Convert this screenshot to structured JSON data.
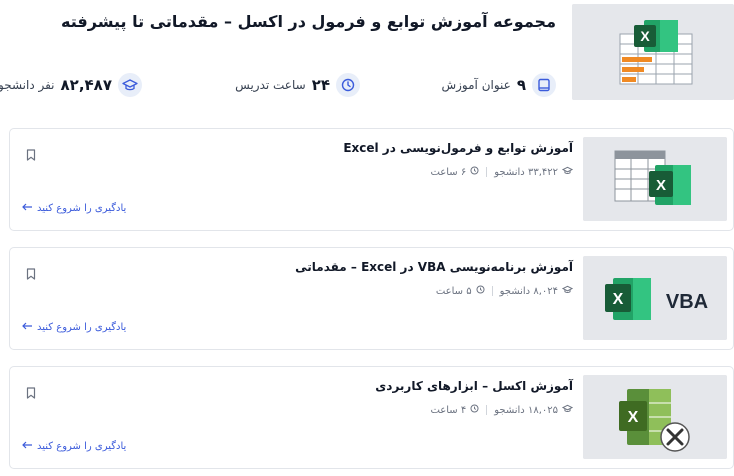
{
  "collection": {
    "title": "مجموعه آموزش توابع و فرمول در اکسل – مقدماتی تا پیشرفته",
    "thumb_icon": "excel-spreadsheet-icon"
  },
  "stats": {
    "courses_value": "۹",
    "courses_label": "عنوان آموزش",
    "hours_value": "۲۴",
    "hours_label": "ساعت تدریس",
    "students_value": "۸۲,۴۸۷",
    "students_label": "نفر دانشجو"
  },
  "courses": [
    {
      "title": "آموزش توابع و فرمول‌نویسی در Excel",
      "students": "۳۳,۴۲۲ دانشجو",
      "duration": "۶ ساعت",
      "cta": "یادگیری را شروع کنید",
      "thumb_icon": "excel-table-icon"
    },
    {
      "title": "آموزش برنامه‌نویسی VBA در Excel – مقدماتی",
      "students": "۸,۰۲۴ دانشجو",
      "duration": "۵ ساعت",
      "cta": "یادگیری را شروع کنید",
      "thumb_icon": "excel-vba-icon",
      "thumb_text": "VBA"
    },
    {
      "title": "آموزش اکسل – ابزارهای کاربردی",
      "students": "۱۸,۰۲۵ دانشجو",
      "duration": "۴ ساعت",
      "cta": "یادگیری را شروع کنید",
      "thumb_icon": "excel-tools-icon"
    }
  ],
  "colors": {
    "excel_green": "#1e7145",
    "excel_light": "#21a366",
    "accent_blue": "#3b5bdb",
    "icon_bg": "#e8eef9"
  }
}
